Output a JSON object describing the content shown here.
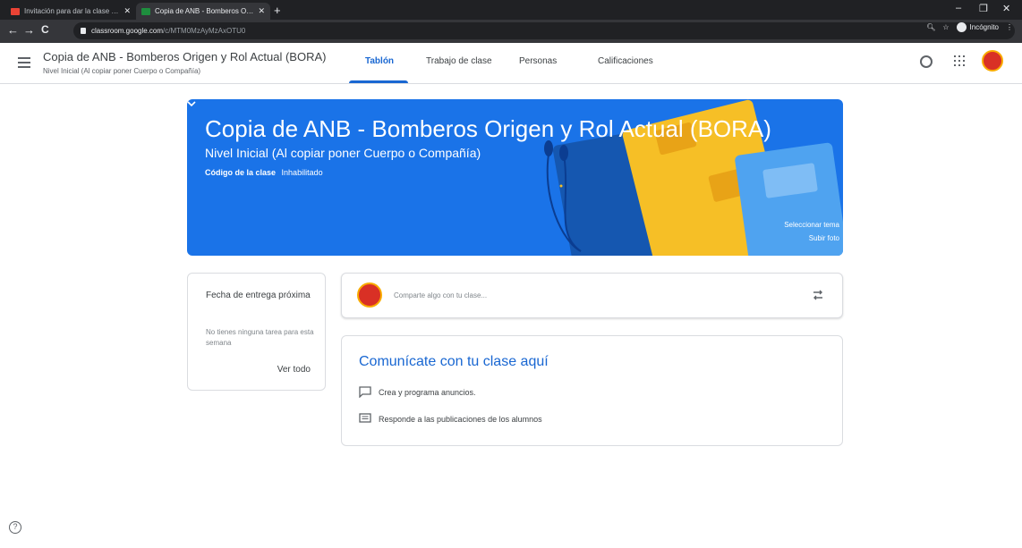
{
  "browser": {
    "tabs": [
      {
        "label": "Invitación para dar la clase de m...",
        "active": false,
        "icon": "gmail-icon"
      },
      {
        "label": "Copia de ANB - Bomberos Origen...",
        "active": true,
        "icon": "classroom-icon"
      }
    ],
    "address": {
      "host": "classroom.google.com",
      "path": "/c/MTM0MzAyMzAxOTU0"
    },
    "incognito_label": "Incógnito",
    "colors": {
      "chrome_dark": "#202124",
      "chrome_mid": "#35363a"
    }
  },
  "header": {
    "class_title": "Copia de ANB - Bomberos Origen y Rol Actual (BORA)",
    "class_subtitle": "Nivel Inicial (Al copiar poner Cuerpo o Compañía)",
    "tabs": [
      {
        "label": "Tablón",
        "active": true
      },
      {
        "label": "Trabajo de clase",
        "active": false
      },
      {
        "label": "Personas",
        "active": false
      },
      {
        "label": "Calificaciones",
        "active": false
      }
    ],
    "icons": [
      "settings-icon",
      "apps-grid-icon",
      "account-avatar"
    ]
  },
  "banner": {
    "title": "Copia de ANB - Bomberos Origen y Rol Actual (BORA)",
    "subtitle": "Nivel Inicial (Al copiar poner Cuerpo o Compañía)",
    "code_label": "Código de la clase",
    "code_value": "Inhabilitado",
    "select_theme": "Seleccionar tema",
    "upload_photo": "Subir foto",
    "color": "#1a73e8"
  },
  "upcoming": {
    "title": "Fecha de entrega próxima",
    "empty": "No tienes ninguna tarea para esta semana",
    "view_all": "Ver todo"
  },
  "share": {
    "placeholder": "Comparte algo con tu clase..."
  },
  "communicate": {
    "title": "Comunícate con tu clase aquí",
    "items": [
      {
        "icon": "announcement-icon",
        "label": "Crea y programa anuncios."
      },
      {
        "icon": "comment-icon",
        "label": "Responde a las publicaciones de los alumnos"
      }
    ]
  },
  "accent": "#1967d2"
}
